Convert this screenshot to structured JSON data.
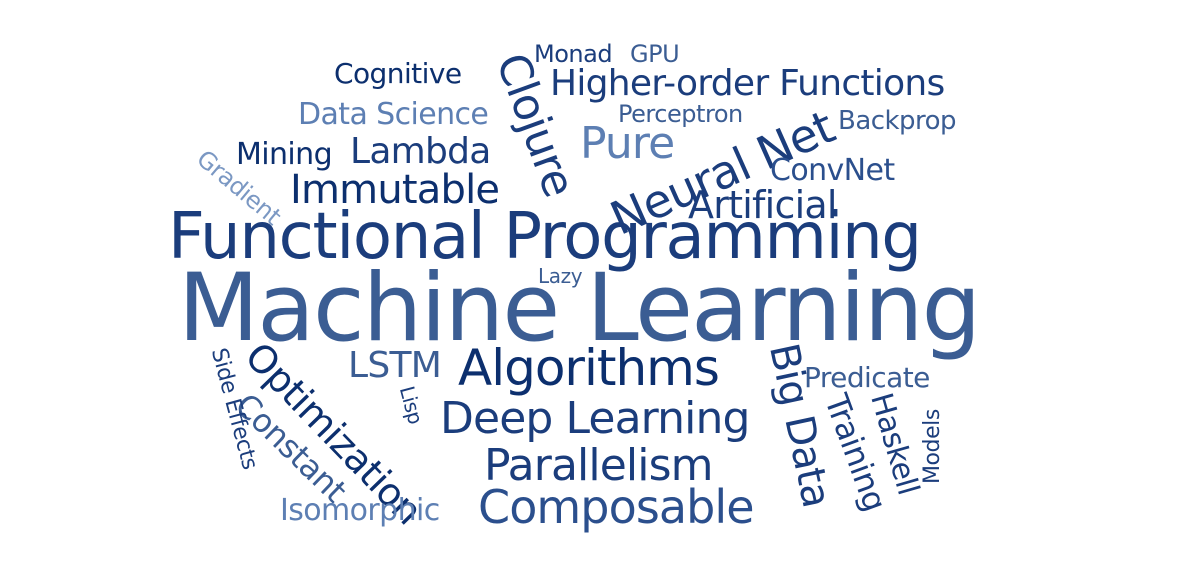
{
  "words": [
    {
      "id": "machine-learning",
      "text": "Machine Learning",
      "color": "#3b5d93"
    },
    {
      "id": "functional-programming",
      "text": "Functional Programming",
      "color": "#1b3d7c"
    },
    {
      "id": "algorithms",
      "text": "Algorithms",
      "color": "#0c2f6e"
    },
    {
      "id": "deep-learning",
      "text": "Deep Learning",
      "color": "#1b3d7c"
    },
    {
      "id": "parallelism",
      "text": "Parallelism",
      "color": "#1b3d7c"
    },
    {
      "id": "composable",
      "text": "Composable",
      "color": "#2b4f8d"
    },
    {
      "id": "immutable",
      "text": "Immutable",
      "color": "#0c2f6e"
    },
    {
      "id": "lambda",
      "text": "Lambda",
      "color": "#1b3d7c"
    },
    {
      "id": "mining",
      "text": "Mining",
      "color": "#0c2f6e"
    },
    {
      "id": "data-science",
      "text": "Data Science",
      "color": "#5d7fb3"
    },
    {
      "id": "cognitive",
      "text": "Cognitive",
      "color": "#0c2f6e"
    },
    {
      "id": "clojure",
      "text": "Clojure",
      "color": "#1b3d7c"
    },
    {
      "id": "monad",
      "text": "Monad",
      "color": "#1b3d7c"
    },
    {
      "id": "gpu",
      "text": "GPU",
      "color": "#3b5d93"
    },
    {
      "id": "higher-order-functions",
      "text": "Higher-order Functions",
      "color": "#1b3d7c"
    },
    {
      "id": "perceptron",
      "text": "Perceptron",
      "color": "#3b5d93"
    },
    {
      "id": "backprop",
      "text": "Backprop",
      "color": "#3b5d93"
    },
    {
      "id": "pure",
      "text": "Pure",
      "color": "#5d7fb3"
    },
    {
      "id": "neural-net",
      "text": "Neural Net",
      "color": "#1b3d7c"
    },
    {
      "id": "convnet",
      "text": "ConvNet",
      "color": "#2b4f8d"
    },
    {
      "id": "artificial",
      "text": "Artificial",
      "color": "#1b3d7c"
    },
    {
      "id": "gradient",
      "text": "Gradient",
      "color": "#7b98c3"
    },
    {
      "id": "lazy",
      "text": "Lazy",
      "color": "#3b5d93"
    },
    {
      "id": "lstm",
      "text": "LSTM",
      "color": "#3b5d93"
    },
    {
      "id": "optimization",
      "text": "Optimization",
      "color": "#0c2f6e"
    },
    {
      "id": "constant",
      "text": "Constant",
      "color": "#3b5d93"
    },
    {
      "id": "side-effects",
      "text": "Side Effects",
      "color": "#1b3d7c"
    },
    {
      "id": "lisp",
      "text": "Lisp",
      "color": "#1b3d7c"
    },
    {
      "id": "isomorphic",
      "text": "Isomorphic",
      "color": "#5d7fb3"
    },
    {
      "id": "big-data",
      "text": "Big Data",
      "color": "#1b3d7c"
    },
    {
      "id": "training",
      "text": "Training",
      "color": "#1b3d7c"
    },
    {
      "id": "haskell",
      "text": "Haskell",
      "color": "#1b3d7c"
    },
    {
      "id": "predicate",
      "text": "Predicate",
      "color": "#3b5d93"
    },
    {
      "id": "models",
      "text": "Models",
      "color": "#1b3d7c"
    }
  ]
}
